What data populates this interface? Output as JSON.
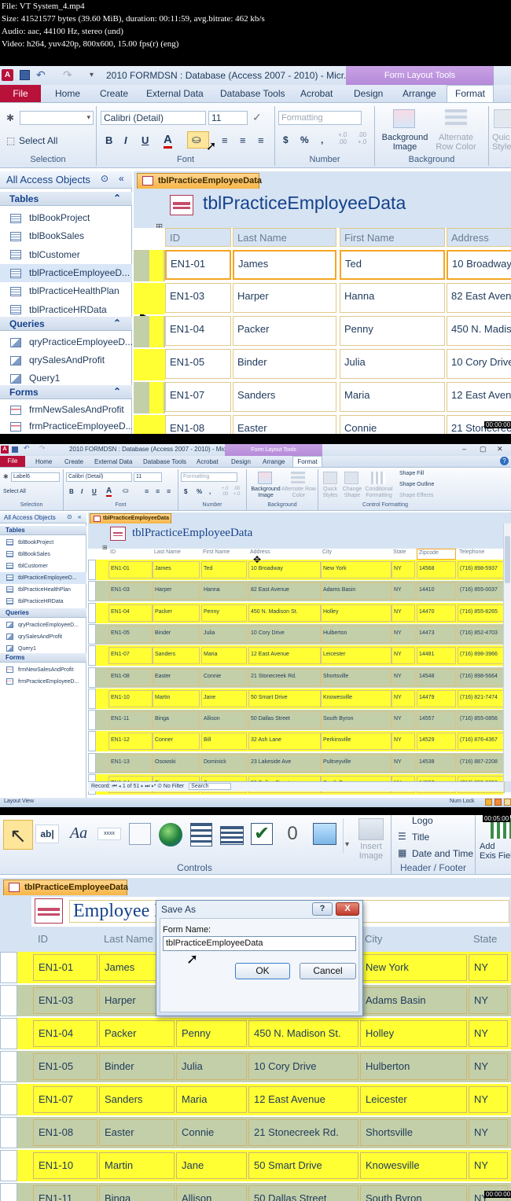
{
  "header": {
    "lines": [
      "File: VT System_4.mp4",
      "Size: 41521577 bytes (39.60 MiB), duration: 00:11:59, avg.bitrate: 462 kb/s",
      "Audio: aac, 44100 Hz, stereo (und)",
      "Video: h264, yuv420p, 800x600, 15.00 fps(r) (eng)"
    ]
  },
  "app": {
    "title": "2010 FORMDSN : Database (Access 2007 - 2010) - Micr...",
    "contextual_title": "Form Layout Tools",
    "file_tab": "File",
    "tabs": [
      "Home",
      "Create",
      "External Data",
      "Database Tools",
      "Acrobat",
      "Design",
      "Arrange",
      "Format"
    ],
    "accent": "#b8113a",
    "highlight": "#ffff33"
  },
  "ribbon": {
    "selection_group": "Selection",
    "select_all": "Select All",
    "font_group": "Font",
    "font_name": "Calibri (Detail)",
    "font_size": "11",
    "number_group": "Number",
    "formatting": "Formatting",
    "background_group": "Background",
    "background_image": "Background Image",
    "alternate_row_color": "Alternate Row Color",
    "quick_styles": "Quick Styles",
    "quick_styles_short": "Quic Styles",
    "control_label_name": "Label6",
    "change_shape": "Change Shape",
    "conditional_formatting": "Conditional Formatting",
    "shape_fill": "Shape Fill",
    "shape_outline": "Shape Outline",
    "shape_effects": "Shape Effects",
    "control_formatting": "Control Formatting",
    "bold": "B",
    "italic": "I",
    "underline": "U",
    "font_color": "A",
    "currency": "$",
    "percent": "%",
    "comma": ",",
    "inc_decimal": "+.0 .00",
    "dec_decimal": ".00 +.0"
  },
  "nav": {
    "header": "All Access Objects",
    "tables_label": "Tables",
    "tables": [
      "tblBookProject",
      "tblBookSales",
      "tblCustomer",
      "tblPracticeEmployeeD...",
      "tblPracticeHealthPlan",
      "tblPracticeHRData"
    ],
    "queries_label": "Queries",
    "queries": [
      "qryPracticeEmployeeD...",
      "qrySalesAndProfit",
      "Query1"
    ],
    "forms_label": "Forms",
    "forms": [
      "frmNewSalesAndProfit",
      "frmPracticeEmployeeD..."
    ]
  },
  "doc": {
    "tab_label": "tblPracticeEmployeeData",
    "form_title": "tblPracticeEmployeeData",
    "form_title_3": "Employee Data",
    "columns": [
      "ID",
      "Last Name",
      "First Name",
      "Address",
      "City",
      "State",
      "Zipcode",
      "Telephone"
    ],
    "rows": [
      [
        "EN1-01",
        "James",
        "Ted",
        "10 Broadway",
        "New York",
        "NY",
        "14568",
        "(716) 898-5937"
      ],
      [
        "EN1-03",
        "Harper",
        "Hanna",
        "82 East Avenue",
        "Adams Basin",
        "NY",
        "14410",
        "(716) 855-0037"
      ],
      [
        "EN1-04",
        "Packer",
        "Penny",
        "450 N. Madison St.",
        "Holley",
        "NY",
        "14470",
        "(716) 855-8265"
      ],
      [
        "EN1-05",
        "Binder",
        "Julia",
        "10 Cory Drive",
        "Hulberton",
        "NY",
        "14473",
        "(716) 852-4703"
      ],
      [
        "EN1-07",
        "Sanders",
        "Maria",
        "12 East Avenue",
        "Leicester",
        "NY",
        "14481",
        "(716) 898-3966"
      ],
      [
        "EN1-08",
        "Easter",
        "Connie",
        "21 Stonecreek Rd.",
        "Shortsville",
        "NY",
        "14548",
        "(716) 898-5664"
      ],
      [
        "EN1-10",
        "Martin",
        "Jane",
        "50 Smart Drive",
        "Knowesville",
        "NY",
        "14479",
        "(716) 821-7474"
      ],
      [
        "EN1-11",
        "Binga",
        "Allison",
        "50 Dallas Street",
        "South Byron",
        "NY",
        "14557",
        "(716) 855-0856"
      ],
      [
        "EN1-12",
        "Conner",
        "Bill",
        "32 Ash Lane",
        "Perkinsville",
        "NY",
        "14529",
        "(716) 876-4367"
      ],
      [
        "EN1-13",
        "Osowski",
        "Dominick",
        "23 Lakeside Ave",
        "Pultneyville",
        "NY",
        "14538",
        "(716) 887-2208"
      ],
      [
        "EN1-14",
        "Binga",
        "Sam",
        "50 Dallas Street",
        "South Byron",
        "NY",
        "14557",
        "(716) 855-0856"
      ]
    ]
  },
  "panel1": {
    "addresses": [
      "10 Broadway",
      "82 East Avenu",
      "450 N. Madis",
      "10 Cory Drive",
      "12 East Avenu",
      "21 Stonecree"
    ]
  },
  "panel2": {
    "record_nav": "Record:",
    "record_pos": "1 of 51",
    "no_filter": "No Filter",
    "search": "Search",
    "status_left": "Layout View",
    "status_right": "Num Lock"
  },
  "panel3": {
    "controls_group": "Controls",
    "header_footer_group": "Header / Footer",
    "logo": "Logo",
    "title": "Title",
    "date_time": "Date and Time",
    "insert_image": "Insert Image",
    "add_existing": "Add Exis Fiel",
    "textbox_glyph": "ab|",
    "label_glyph": "Aa",
    "button_glyph": "xxxx",
    "attach_glyph": "0",
    "dialog": {
      "title": "Save As",
      "help": "?",
      "close": "X",
      "field_label": "Form Name:",
      "field_value": "tblPracticeEmployeeData",
      "ok": "OK",
      "cancel": "Cancel"
    },
    "address_cut": "450 N. Madison St."
  },
  "timestamps": [
    "00:05:00",
    "00:00:00",
    "00:00:00"
  ],
  "cursor": "arrow"
}
